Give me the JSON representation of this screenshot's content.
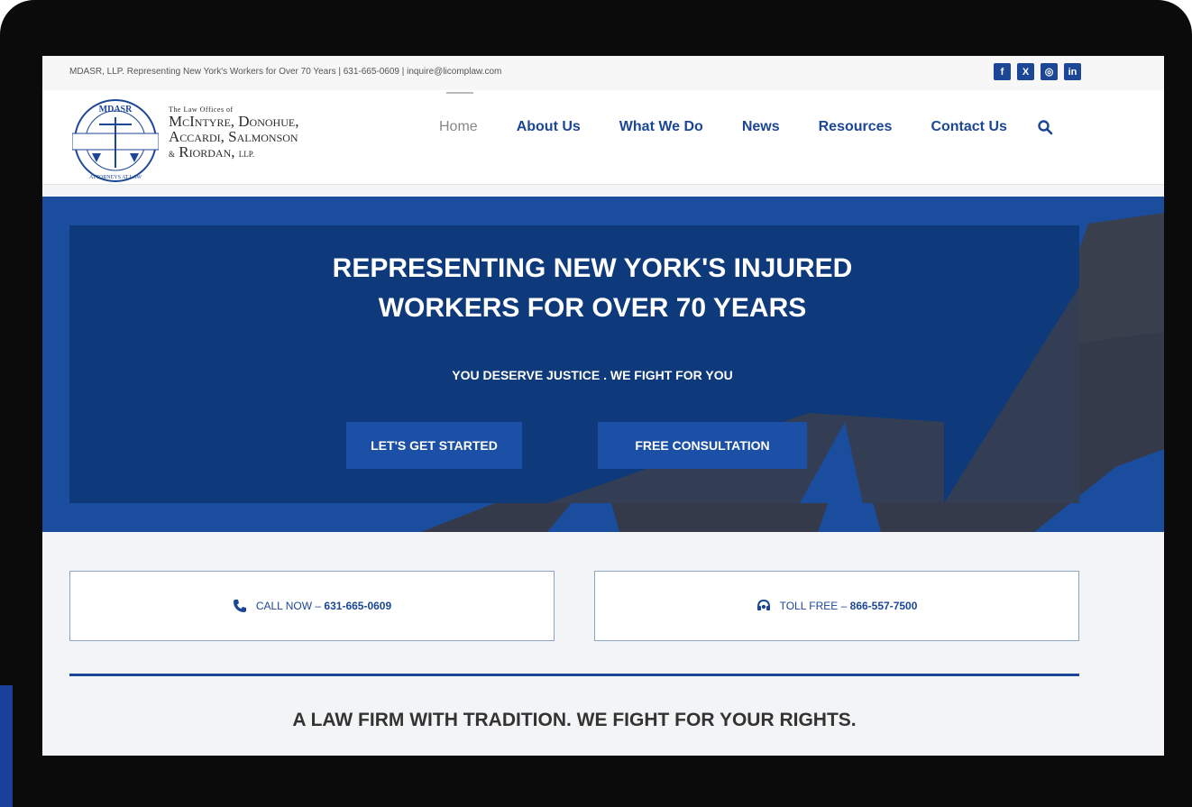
{
  "topbar": {
    "text": "MDASR, LLP. Representing New York's Workers for Over 70 Years | 631-665-0609 | inquire@licomplaw.com",
    "socials": [
      {
        "name": "facebook-icon",
        "glyph": "f"
      },
      {
        "name": "x-icon",
        "glyph": "X"
      },
      {
        "name": "instagram-icon",
        "glyph": "◎"
      },
      {
        "name": "linkedin-icon",
        "glyph": "in"
      }
    ]
  },
  "logo": {
    "seal_top": "MDASR",
    "seal_bottom": "ATTORNEYS AT LAW",
    "line0": "The Law Offices of",
    "line1": "McIntyre, Donohue,",
    "line2": "Accardi, Salmonson",
    "line3_amp": "&",
    "line3": "Riordan,",
    "line3_llp": "LLP."
  },
  "nav": {
    "items": [
      "Home",
      "About Us",
      "What We Do",
      "News",
      "Resources",
      "Contact Us"
    ],
    "active": "Home"
  },
  "hero": {
    "title_line1": "REPRESENTING NEW YORK'S INJURED",
    "title_line2": "WORKERS FOR OVER 70 YEARS",
    "subtitle": "YOU DESERVE JUSTICE . WE FIGHT FOR YOU",
    "btn_start": "LET'S GET STARTED",
    "btn_consult": "FREE CONSULTATION"
  },
  "contact": {
    "call_label": "CALL NOW –",
    "call_number": "631-665-0609",
    "toll_label": "TOLL FREE –",
    "toll_number": "866-557-7500"
  },
  "tagline": "A LAW FIRM WITH TRADITION. WE FIGHT FOR YOUR RIGHTS.",
  "colors": {
    "brand_blue": "#1c4696",
    "hero_blue": "#1b4d9e",
    "panel_navy": "#0e3a7c"
  }
}
